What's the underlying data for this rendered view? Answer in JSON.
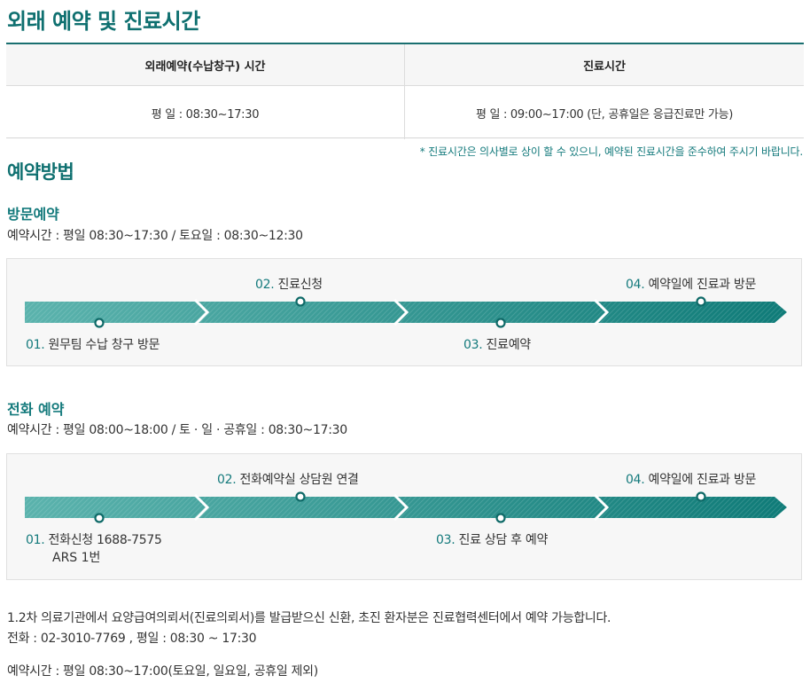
{
  "page_title": "외래 예약 및 진료시간",
  "hours_table": {
    "headers": [
      "외래예약(수납창구) 시간",
      "진료시간"
    ],
    "values": [
      "평 일 : 08:30~17:30",
      "평 일 : 09:00~17:00 (단, 공휴일은 응급진료만 가능)"
    ]
  },
  "note": "* 진료시간은 의사별로 상이 할 수 있으니, 예약된 진료시간을 준수하여 주시기 바랍니다.",
  "reservation": {
    "title": "예약방법",
    "visit": {
      "title": "방문예약",
      "hours": "예약시간 : 평일 08:30~17:30 / 토요일 : 08:30~12:30",
      "steps": [
        {
          "num": "01.",
          "label": "원무팀 수납 창구 방문"
        },
        {
          "num": "02.",
          "label": "진료신청"
        },
        {
          "num": "03.",
          "label": "진료예약"
        },
        {
          "num": "04.",
          "label": "예약일에 진료과 방문"
        }
      ]
    },
    "phone": {
      "title": "전화 예약",
      "hours": "예약시간 : 평일 08:00~18:00 / 토 · 일 · 공휴일 : 08:30~17:30",
      "steps": [
        {
          "num": "01.",
          "label": "전화신청 1688-7575",
          "sub": "ARS 1번"
        },
        {
          "num": "02.",
          "label": "전화예약실 상담원 연결"
        },
        {
          "num": "03.",
          "label": "진료 상담 후 예약"
        },
        {
          "num": "04.",
          "label": "예약일에 진료과 방문"
        }
      ]
    }
  },
  "referral": {
    "text": "1.2차 의료기관에서 요양급여의뢰서(진료의뢰서)를 발급받으신 신환, 초진 환자분은 진료협력센터에서 예약 가능합니다.",
    "phone": "전화 : 02-3010-7769 , 평일 : 08:30 ~ 17:30",
    "hours": "예약시간 : 평일 08:30~17:00(토요일, 일요일, 공휴일 제외)"
  },
  "colors": {
    "accent": "#147a7c",
    "arrow_light": "#4aa9a4",
    "arrow_dark": "#0f7b78"
  }
}
